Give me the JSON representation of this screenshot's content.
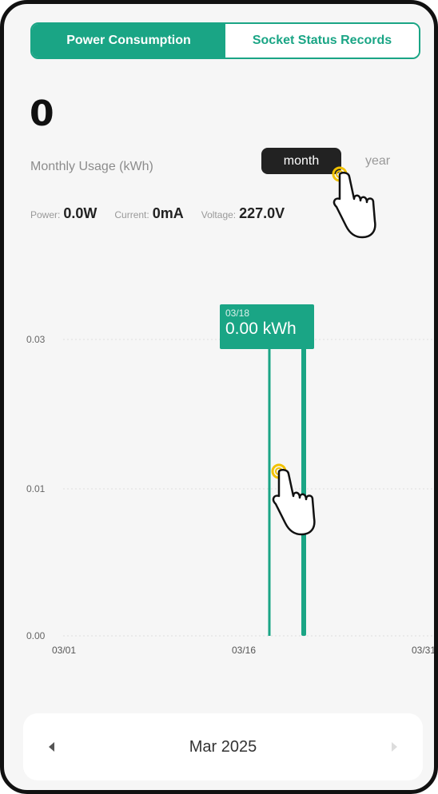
{
  "tabs": [
    {
      "label": "Power Consumption",
      "active": true
    },
    {
      "label": "Socket Status Records",
      "active": false
    }
  ],
  "usage": {
    "value": "0",
    "label": "Monthly Usage (kWh)"
  },
  "range_toggle": {
    "options": [
      "month",
      "year"
    ],
    "selected": "month"
  },
  "stats": {
    "power_label": "Power:",
    "power_value": "0.0W",
    "current_label": "Current:",
    "current_value": "0mA",
    "voltage_label": "Voltage:",
    "voltage_value": "227.0V"
  },
  "chart_data": {
    "type": "bar",
    "y_ticks": [
      "0.03",
      "0.01",
      "0.00"
    ],
    "x_ticks": [
      "03/01",
      "03/16",
      "03/31"
    ],
    "bars": [
      {
        "date": "03/18",
        "value": 0.0
      },
      {
        "date": "03/21",
        "value": 0.03
      }
    ],
    "tooltip": {
      "date": "03/18",
      "value": "0.00 kWh"
    }
  },
  "month_nav": {
    "label": "Mar 2025"
  },
  "colors": {
    "accent": "#1aa585",
    "dark": "#222222"
  }
}
